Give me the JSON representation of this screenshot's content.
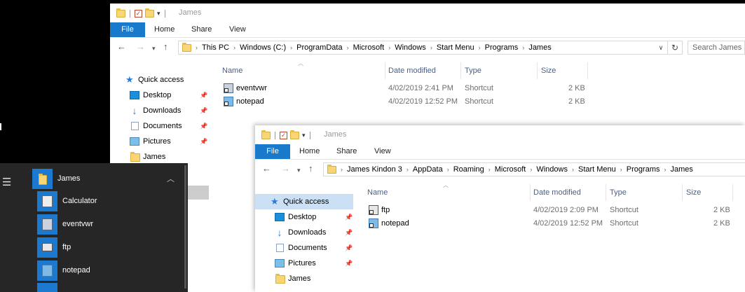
{
  "window1": {
    "title": "James",
    "tabs": {
      "file": "File",
      "home": "Home",
      "share": "Share",
      "view": "View"
    },
    "breadcrumb": [
      "This PC",
      "Windows (C:)",
      "ProgramData",
      "Microsoft",
      "Windows",
      "Start Menu",
      "Programs",
      "James"
    ],
    "search_placeholder": "Search James",
    "sidebar": {
      "quick_access": "Quick access",
      "items": [
        "Desktop",
        "Downloads",
        "Documents",
        "Pictures",
        "James"
      ]
    },
    "columns": {
      "name": "Name",
      "date": "Date modified",
      "type": "Type",
      "size": "Size"
    },
    "files": [
      {
        "name": "eventvwr",
        "date": "4/02/2019 2:41 PM",
        "type": "Shortcut",
        "size": "2 KB"
      },
      {
        "name": "notepad",
        "date": "4/02/2019 12:52 PM",
        "type": "Shortcut",
        "size": "2 KB"
      }
    ]
  },
  "window2": {
    "title": "James",
    "tabs": {
      "file": "File",
      "home": "Home",
      "share": "Share",
      "view": "View"
    },
    "breadcrumb": [
      "James Kindon 3",
      "AppData",
      "Roaming",
      "Microsoft",
      "Windows",
      "Start Menu",
      "Programs",
      "James"
    ],
    "sidebar": {
      "quick_access": "Quick access",
      "items": [
        "Desktop",
        "Downloads",
        "Documents",
        "Pictures",
        "James"
      ]
    },
    "columns": {
      "name": "Name",
      "date": "Date modified",
      "type": "Type",
      "size": "Size"
    },
    "files": [
      {
        "name": "ftp",
        "date": "4/02/2019 2:09 PM",
        "type": "Shortcut",
        "size": "2 KB"
      },
      {
        "name": "notepad",
        "date": "4/02/2019 12:52 PM",
        "type": "Shortcut",
        "size": "2 KB"
      }
    ]
  },
  "start_menu": {
    "group": "James",
    "items": [
      "Calculator",
      "eventvwr",
      "ftp",
      "notepad"
    ]
  },
  "colors": {
    "file_tab": "#1979ca",
    "tile": "#1b7ad0",
    "selected": "#cce0f5",
    "start_bg": "#262626"
  }
}
